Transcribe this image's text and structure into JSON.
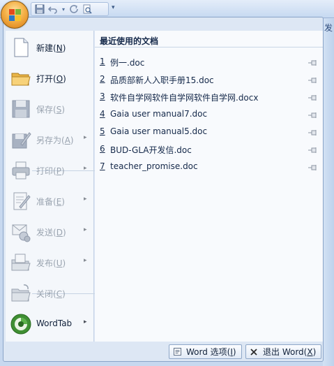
{
  "quick_access": {
    "tools": [
      "save-icon",
      "undo-icon",
      "undo-dropdown-icon",
      "redo-icon",
      "print-preview-icon"
    ],
    "customize_glyph": "▾"
  },
  "edge_glyph": "发",
  "menu": {
    "items": [
      {
        "label": "新建",
        "key": "N",
        "icon": "new-document-icon",
        "enabled": true,
        "submenu": false
      },
      {
        "label": "打开",
        "key": "O",
        "icon": "open-folder-icon",
        "enabled": true,
        "submenu": false
      },
      {
        "label": "保存",
        "key": "S",
        "icon": "save-icon",
        "enabled": false,
        "submenu": false
      },
      {
        "label": "另存为",
        "key": "A",
        "icon": "save-as-icon",
        "enabled": false,
        "submenu": true
      },
      {
        "label": "打印",
        "key": "P",
        "icon": "print-icon",
        "enabled": false,
        "submenu": true
      },
      {
        "label": "准备",
        "key": "E",
        "icon": "prepare-icon",
        "enabled": false,
        "submenu": true
      },
      {
        "label": "发送",
        "key": "D",
        "icon": "send-icon",
        "enabled": false,
        "submenu": true
      },
      {
        "label": "发布",
        "key": "U",
        "icon": "publish-icon",
        "enabled": false,
        "submenu": true
      },
      {
        "label": "关闭",
        "key": "C",
        "icon": "close-document-icon",
        "enabled": false,
        "submenu": false
      },
      {
        "label": "WordTab",
        "key": "",
        "icon": "wordtab-icon",
        "enabled": true,
        "submenu": true
      }
    ],
    "arrow_glyph": "▸"
  },
  "recent": {
    "header": "最近使用的文档",
    "docs": [
      {
        "num": "1",
        "name": "例一.doc"
      },
      {
        "num": "2",
        "name": "品质部新人入职手册15.doc"
      },
      {
        "num": "3",
        "name": "软件自学网软件自学网软件自学网.docx"
      },
      {
        "num": "4",
        "name": "Gaia user manual7.doc"
      },
      {
        "num": "5",
        "name": "Gaia user manual5.doc"
      },
      {
        "num": "6",
        "name": "BUD-GLA开发信.doc"
      },
      {
        "num": "7",
        "name": "teacher_promise.doc"
      }
    ]
  },
  "footer": {
    "options_label": "Word 选项",
    "options_key": "I",
    "exit_label": "退出 Word",
    "exit_key": "X"
  }
}
